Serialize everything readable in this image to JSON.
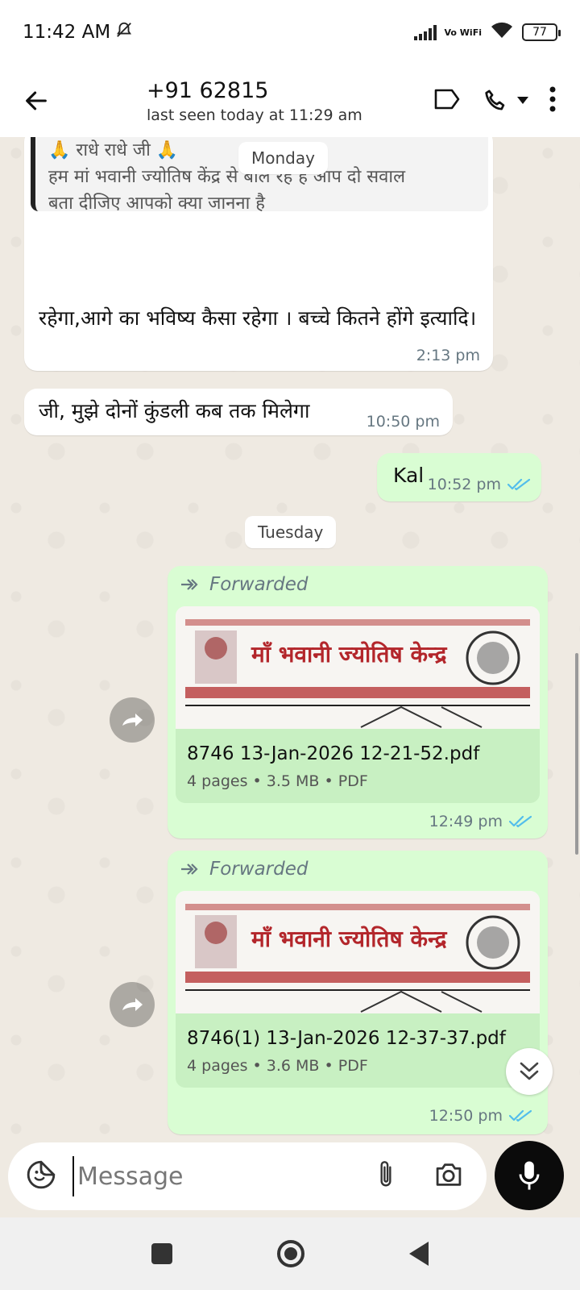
{
  "status_bar": {
    "time": "11:42 AM",
    "network": "Vo WiFi",
    "battery": "77"
  },
  "header": {
    "contact": "+91 62815",
    "last_seen": "last seen today at 11:29 am"
  },
  "dates": {
    "monday": "Monday",
    "tuesday": "Tuesday"
  },
  "messages": {
    "quoted": {
      "line1": "🙏 राधे राधे जी 🙏",
      "line2": "हम मां भवानी ज्योतिष केंद्र से बोल रहे हैं आप दो सवाल",
      "line3": "बता दीजिए आपको क्या जानना है"
    },
    "m1": {
      "text": "रहेगा,आगे का भविष्य कैसा रहेगा । बच्चे कितने होंगे इत्यादि।",
      "time": "2:13 pm"
    },
    "m2": {
      "text": "जी, मुझे दोनों कुंडली कब तक मिलेगा",
      "time": "10:50 pm"
    },
    "m3": {
      "text": "Kal",
      "time": "10:52 pm"
    },
    "doc1": {
      "forwarded": "Forwarded",
      "thumb_title": "माँ भवानी ज्योतिष केन्द्र",
      "name": "8746 13-Jan-2026 12-21-52.pdf",
      "meta": "4 pages • 3.5 MB • PDF",
      "time": "12:49 pm"
    },
    "doc2": {
      "forwarded": "Forwarded",
      "thumb_title": "माँ भवानी ज्योतिष केन्द्र",
      "name": "8746(1) 13-Jan-2026 12-37-37.pdf",
      "meta": "4 pages • 3.6 MB • PDF",
      "time": "12:50 pm"
    }
  },
  "input": {
    "placeholder": "Message"
  },
  "colors": {
    "outgoing": "#d9fdd3",
    "incoming": "#ffffff",
    "tick": "#53bdeb",
    "background": "#efeae2"
  }
}
